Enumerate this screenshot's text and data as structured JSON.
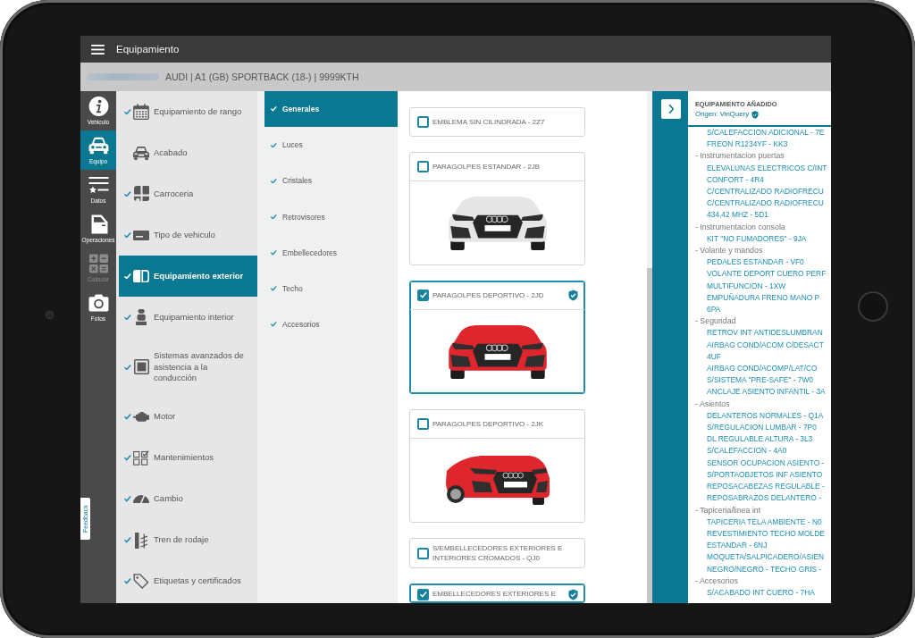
{
  "app_bar": {
    "title": "Equipamiento"
  },
  "vehicle_bar": {
    "description": "AUDI | A1 (GB) SPORTBACK (18-) | 9999KTH"
  },
  "nav_rail": [
    {
      "label": "Vehiculo",
      "selected": false,
      "disabled": false
    },
    {
      "label": "Equipo",
      "selected": true,
      "disabled": false
    },
    {
      "label": "Datos",
      "selected": false,
      "disabled": false
    },
    {
      "label": "Operaciones",
      "selected": false,
      "disabled": false
    },
    {
      "label": "Calcular",
      "selected": false,
      "disabled": true
    },
    {
      "label": "Fotos",
      "selected": false,
      "disabled": false
    }
  ],
  "feedback_tab": {
    "label": "Feedback"
  },
  "categories": [
    {
      "label": "Equipamiento de rango",
      "checked": true,
      "selected": false
    },
    {
      "label": "Acabado",
      "checked": false,
      "selected": false
    },
    {
      "label": "Carroceria",
      "checked": true,
      "selected": false
    },
    {
      "label": "Tipo de vehiculo",
      "checked": true,
      "selected": false
    },
    {
      "label": "Equipamiento exterior",
      "checked": true,
      "selected": true
    },
    {
      "label": "Equipamiento interior",
      "checked": true,
      "selected": false
    },
    {
      "label": "Sistemas avanzados de asistencia a la conducción",
      "checked": true,
      "selected": false
    },
    {
      "label": "Motor",
      "checked": true,
      "selected": false
    },
    {
      "label": "Mantenimientos",
      "checked": true,
      "selected": false
    },
    {
      "label": "Cambio",
      "checked": true,
      "selected": false
    },
    {
      "label": "Tren de rodaje",
      "checked": true,
      "selected": false
    },
    {
      "label": "Etiquetas y certificados",
      "checked": true,
      "selected": false
    }
  ],
  "subcategories": [
    {
      "label": "Generales",
      "checked": true,
      "selected": true
    },
    {
      "label": "Luces",
      "checked": true,
      "selected": false
    },
    {
      "label": "Cristales",
      "checked": true,
      "selected": false
    },
    {
      "label": "Retrovisores",
      "checked": true,
      "selected": false
    },
    {
      "label": "Embellecedores",
      "checked": true,
      "selected": false
    },
    {
      "label": "Techo",
      "checked": true,
      "selected": false
    },
    {
      "label": "Accesorios",
      "checked": true,
      "selected": false
    }
  ],
  "options": [
    {
      "title": "EMBLEMA SIN CILINDRADA - 2Z7",
      "checked": false,
      "verified": false
    },
    {
      "title": "PARAGOLPES ESTANDAR - 2JB",
      "checked": false,
      "verified": false,
      "photo": {
        "kind": "front",
        "color": "#e6e6e6"
      }
    },
    {
      "title": "PARAGOLPES DEPORTIVO - 2JD",
      "checked": true,
      "verified": true,
      "photo": {
        "kind": "front",
        "color": "#e0262d"
      }
    },
    {
      "title": "PARAGOLPES DEPORTIVO - 2JK",
      "checked": false,
      "verified": false,
      "photo": {
        "kind": "angled",
        "color": "#e0262d"
      }
    },
    {
      "title": "S/EMBELLECEDORES EXTERIORES E INTERIORES CROMADOS - QJ0",
      "checked": false,
      "verified": false
    },
    {
      "title": "EMBELLECEDORES EXTERIORES E",
      "checked": true,
      "verified": true
    }
  ],
  "added_equipment": {
    "title": "EQUIPAMIENTO AÑADIDO",
    "origin": "Origen: VinQuery",
    "groups": [
      {
        "children": [
          {
            "lines": [
              "S/CALEFACCION ADICIONAL - 7E"
            ]
          },
          {
            "lines": [
              "FREON R1234YF - KK3"
            ]
          }
        ]
      },
      {
        "label": "- Instrumentacion puertas",
        "children": [
          {
            "lines": [
              "ELEVALUNAS ELECTRICOS C/INT",
              "CONFORT - 4R4"
            ]
          },
          {
            "lines": [
              "C/CENTRALIZADO RADIOFRECU"
            ]
          },
          {
            "lines": [
              "C/CENTRALIZADO RADIOFRECU",
              "434,42 MHZ - 5D1"
            ]
          }
        ]
      },
      {
        "label": "- Instrumentacion consola",
        "children": [
          {
            "lines": [
              "KIT \"NO FUMADORES\" - 9JA"
            ]
          }
        ]
      },
      {
        "label": "- Volante y mandos",
        "children": [
          {
            "lines": [
              "PEDALES ESTANDAR - VF0"
            ]
          },
          {
            "lines": [
              "VOLANTE DEPORT CUERO PERF",
              "MULTIFUNCION - 1XW"
            ]
          },
          {
            "lines": [
              "EMPUÑADURA FRENO MANO P",
              "6PA"
            ]
          }
        ]
      },
      {
        "label": "- Seguridad",
        "children": [
          {
            "lines": [
              "RETROV INT ANTIDESLUMBRAN"
            ]
          },
          {
            "lines": [
              "AIRBAG COND/ACOM C/DESACT",
              "4UF"
            ]
          },
          {
            "lines": [
              "AIRBAG COND/ACOMP/LAT/CO"
            ]
          },
          {
            "lines": [
              "S/SISTEMA \"PRE-SAFE\" - 7W0"
            ]
          },
          {
            "lines": [
              "ANCLAJE ASIENTO INFANTIL - 3A"
            ]
          }
        ]
      },
      {
        "label": "- Asientos",
        "children": [
          {
            "lines": [
              "DELANTEROS NORMALES - Q1A"
            ]
          },
          {
            "lines": [
              "S/REGULACION LUMBAR - 7P0"
            ]
          },
          {
            "lines": [
              "DL REGULABLE ALTURA - 3L3"
            ]
          },
          {
            "lines": [
              "S/CALEFACCION - 4A0"
            ]
          },
          {
            "lines": [
              "SENSOR OCUPACION ASIENTO -"
            ]
          },
          {
            "lines": [
              "S/PORTAOBJETOS INF ASIENTO"
            ]
          },
          {
            "lines": [
              "REPOSACABEZAS REGULABLE -"
            ]
          },
          {
            "lines": [
              "REPOSABRAZOS DELANTERO -"
            ]
          }
        ]
      },
      {
        "label": "- Tapiceria/linea int",
        "children": [
          {
            "lines": [
              "TAPICERIA TELA AMBIENTE - N0"
            ]
          },
          {
            "lines": [
              "REVESTIMIENTO TECHO MOLDE",
              "ESTANDAR - 6NJ"
            ]
          },
          {
            "lines": [
              "MOQUETA/SALPICADERO/ASIEN",
              "NEGRO/NEGRO - TECHO GRIS -"
            ]
          }
        ]
      },
      {
        "label": "- Accesorios",
        "children": [
          {
            "lines": [
              "S/ACABADO INT CUERO - 7HA"
            ]
          }
        ]
      }
    ]
  }
}
